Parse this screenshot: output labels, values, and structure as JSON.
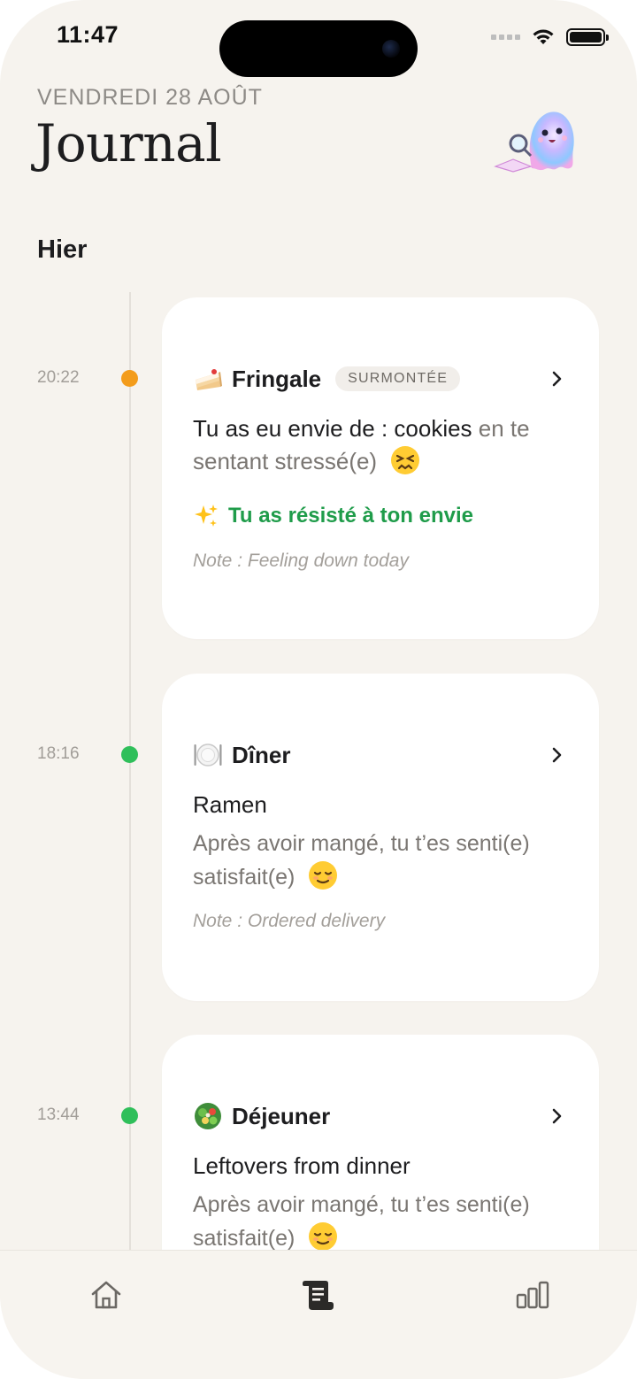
{
  "status_bar": {
    "time": "11:47"
  },
  "header": {
    "date": "VENDREDI 28 AOÛT",
    "title": "Journal"
  },
  "section": {
    "title": "Hier"
  },
  "colors": {
    "craving_dot": "#f39c1b",
    "meal_dot": "#2fbf5a",
    "success": "#1f9c4a",
    "background": "#f6f3ee"
  },
  "entries": [
    {
      "time": "20:22",
      "icon": "cake-icon",
      "title": "Fringale",
      "badge": "SURMONTÉE",
      "text_main": "Tu as eu envie de : cookies",
      "text_muted": " en te sentant stressé(e)",
      "mood_icon": "persevering-face-icon",
      "success": "Tu as résisté à ton envie",
      "note": "Note : Feeling down today"
    },
    {
      "time": "18:16",
      "icon": "plate-icon",
      "title": "Dîner",
      "meal": "Ramen",
      "feeling": "Après avoir mangé, tu t’es senti(e) satisfait(e)",
      "mood_icon": "relieved-face-icon",
      "note": "Note : Ordered delivery"
    },
    {
      "time": "13:44",
      "icon": "salad-icon",
      "title": "Déjeuner",
      "meal": "Leftovers from dinner",
      "feeling": "Après avoir mangé, tu t’es senti(e) satisfait(e)",
      "mood_icon": "relieved-face-icon"
    }
  ],
  "tabbar": {
    "tabs": [
      "home-icon",
      "journal-icon",
      "stats-icon"
    ],
    "active": "journal-icon"
  }
}
